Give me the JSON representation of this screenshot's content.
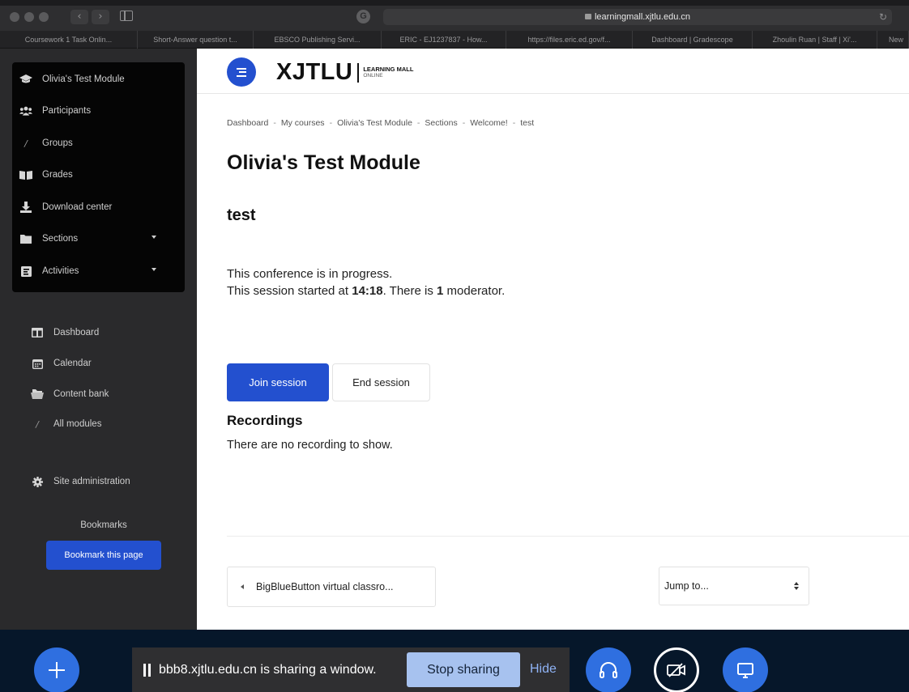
{
  "browser": {
    "url": "learningmall.xjtlu.edu.cn",
    "tabs": [
      "Coursework 1 Task Onlin...",
      "Short-Answer question t...",
      "EBSCO Publishing Servi...",
      "ERIC - EJ1237837 - How...",
      "https://files.eric.ed.gov/f...",
      "Dashboard | Gradescope",
      "Zhoulin Ruan | Staff | Xi'...",
      "New"
    ]
  },
  "drawer": {
    "course_items": [
      {
        "label": "Olivia's Test Module",
        "icon": "graduation-cap-icon"
      },
      {
        "label": "Participants",
        "icon": "users-icon"
      },
      {
        "label": "Groups",
        "icon": "group-icon"
      },
      {
        "label": "Grades",
        "icon": "grades-icon"
      },
      {
        "label": "Download center",
        "icon": "download-icon"
      },
      {
        "label": "Sections",
        "icon": "folder-icon"
      },
      {
        "label": "Activities",
        "icon": "activities-icon"
      }
    ],
    "site_items": [
      {
        "label": "Dashboard",
        "icon": "dashboard-icon"
      },
      {
        "label": "Calendar",
        "icon": "calendar-icon"
      },
      {
        "label": "Content bank",
        "icon": "content-bank-icon"
      },
      {
        "label": "All modules",
        "icon": "modules-icon"
      },
      {
        "label": "Site administration",
        "icon": "gear-icon"
      }
    ],
    "bookmarks_label": "Bookmarks",
    "bookmark_button": "Bookmark this page"
  },
  "header": {
    "logo_main": "XJTLU",
    "logo_line1": "LEARNING MALL",
    "logo_line2": "ONLINE"
  },
  "breadcrumb": [
    "Dashboard",
    "My courses",
    "Olivia's Test Module",
    "Sections",
    "Welcome!",
    "test"
  ],
  "page": {
    "title": "Olivia's Test Module",
    "activity_name": "test",
    "status_line1": "This conference is in progress.",
    "status_line2_a": "This session started at ",
    "status_time": "14:18",
    "status_line2_b": ". There is ",
    "status_moderators": "1",
    "status_line2_c": " moderator.",
    "join_button": "Join session",
    "end_button": "End session",
    "recordings_heading": "Recordings",
    "recordings_empty": "There are no recording to show.",
    "prev_activity": "BigBlueButton virtual classro...",
    "jump_to": "Jump to..."
  },
  "bbb": {
    "share_message": "bbb8.xjtlu.edu.cn is sharing a window.",
    "stop_sharing": "Stop sharing",
    "hide": "Hide"
  },
  "colors": {
    "brand_blue": "#2350cf",
    "bbb_blue": "#2f6fe0",
    "bbb_bar": "#06172a"
  }
}
